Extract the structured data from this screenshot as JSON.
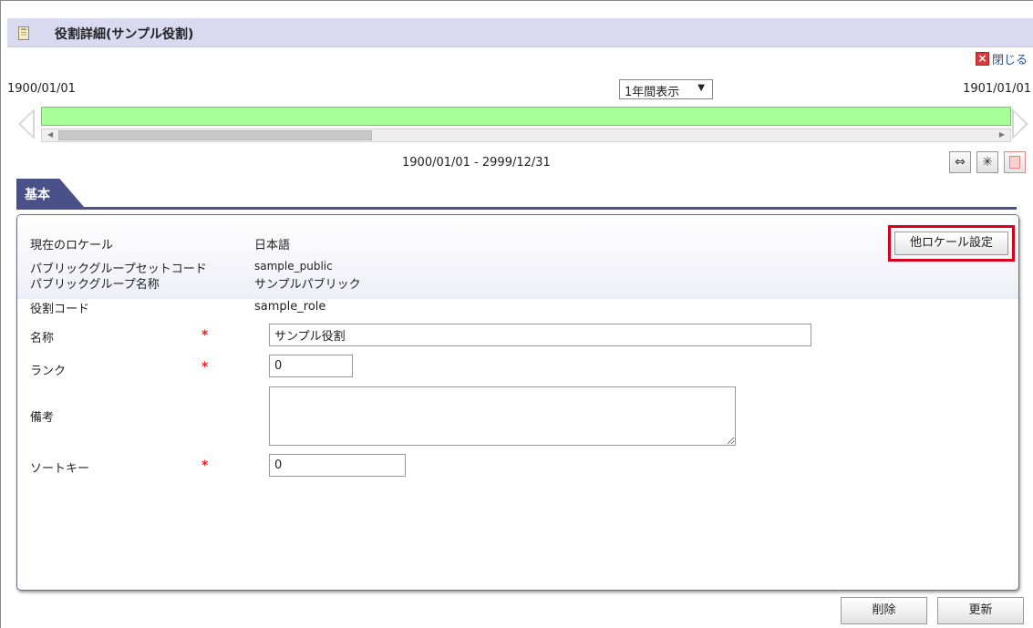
{
  "header": {
    "title": "役割詳細(サンプル役割)",
    "close_label": "閉じる"
  },
  "timeline": {
    "start_date": "1900/01/01",
    "end_date": "1901/01/01",
    "period_selected": "1年間表示",
    "range_label": "1900/01/01 - 2999/12/31"
  },
  "tabs": [
    {
      "label": "基本",
      "active": true
    }
  ],
  "form": {
    "current_locale_label": "現在のロケール",
    "current_locale_value": "日本語",
    "other_locale_button": "他ロケール設定",
    "public_group_set_code_label": "パブリックグループセットコード",
    "public_group_set_code_value": "sample_public",
    "public_group_name_label": "パブリックグループ名称",
    "public_group_name_value": "サンプルパブリック",
    "role_code_label": "役割コード",
    "role_code_value": "sample_role",
    "name_label": "名称",
    "name_value": "サンプル役割",
    "rank_label": "ランク",
    "rank_value": "0",
    "remarks_label": "備考",
    "remarks_value": "",
    "sort_key_label": "ソートキー",
    "sort_key_value": "0",
    "required_mark": "*"
  },
  "footer": {
    "delete_label": "削除",
    "update_label": "更新"
  },
  "colors": {
    "tab_bg": "#4a5189",
    "title_bar_bg": "#d9d9f0",
    "timeline_bar": "#a8ff99",
    "highlight_border": "#d6001c",
    "required": "#e42020"
  },
  "icons": {
    "title": "document-icon",
    "close": "close-x-icon",
    "fit": "fit-width-icon",
    "new": "sparkle-icon",
    "delete": "delete-icon"
  }
}
